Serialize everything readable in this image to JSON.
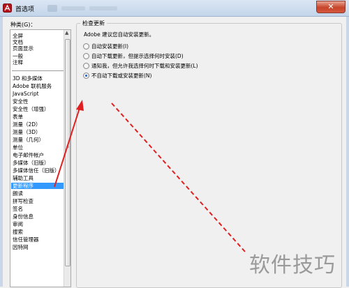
{
  "window": {
    "title": "首选项",
    "close_glyph": "✕",
    "app_icon": "acrobat-icon"
  },
  "categories": {
    "label": "种类(G)：",
    "top_items": [
      "全屏",
      "文档",
      "页面显示",
      "一般",
      "注释"
    ],
    "items": [
      "3D 和多媒体",
      "Adobe 联机服务",
      "JavaScript",
      "安全性",
      "安全性（增强）",
      "表单",
      "测量（2D）",
      "测量（3D）",
      "测量（几何）",
      "单位",
      "电子邮件帐户",
      "多媒体（旧版）",
      "多媒体信任（旧版）",
      "辅助工具",
      "更新程序",
      "朗读",
      "拼写检查",
      "签名",
      "身份信息",
      "审阅",
      "搜索",
      "信任管理器",
      "因特网"
    ],
    "selected": "更新程序"
  },
  "update_panel": {
    "title": "检查更新",
    "description": "Adobe 建议您自动安装更新。",
    "options": [
      {
        "label": "自动安装更新(I)",
        "checked": false
      },
      {
        "label": "自动下载更新，但提示选择何时安装(D)",
        "checked": false
      },
      {
        "label": "通知我，但允许我选择何时下载和安装更新(L)",
        "checked": false
      },
      {
        "label": "不自动下载或安装更新(N)",
        "checked": true
      }
    ]
  },
  "watermark": "软件技巧",
  "colors": {
    "selection": "#3399ff",
    "annotation": "#e02020",
    "titlebar": "#c3d5ea",
    "close_button": "#c7452a"
  }
}
